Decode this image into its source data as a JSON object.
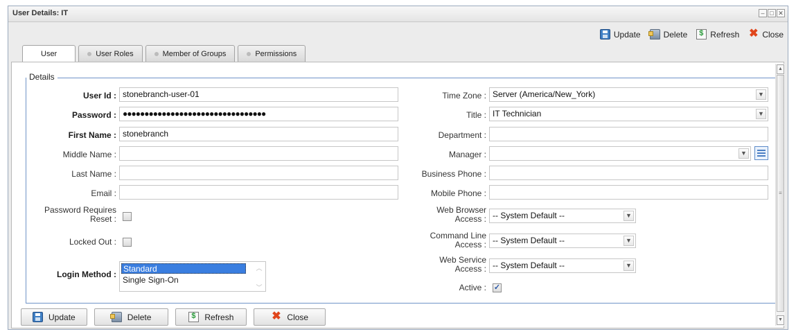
{
  "window": {
    "title": "User Details: IT"
  },
  "toolbar": {
    "update": {
      "label": "Update",
      "icon": "save-icon"
    },
    "delete": {
      "label": "Delete",
      "icon": "delete-icon"
    },
    "refresh": {
      "label": "Refresh",
      "icon": "refresh-icon"
    },
    "close": {
      "label": "Close",
      "icon": "close-icon"
    }
  },
  "tabs": [
    {
      "label": "User",
      "active": true
    },
    {
      "label": "User Roles",
      "active": false
    },
    {
      "label": "Member of Groups",
      "active": false
    },
    {
      "label": "Permissions",
      "active": false
    }
  ],
  "details": {
    "legend": "Details",
    "user_id": {
      "label": "User Id :",
      "value": "stonebranch-user-01"
    },
    "password": {
      "label": "Password :",
      "value": "●●●●●●●●●●●●●●●●●●●●●●●●●●●●●●●●●"
    },
    "first_name": {
      "label": "First Name :",
      "value": "stonebranch"
    },
    "middle_name": {
      "label": "Middle Name :",
      "value": ""
    },
    "last_name": {
      "label": "Last Name :",
      "value": ""
    },
    "email": {
      "label": "Email :",
      "value": ""
    },
    "password_reset": {
      "label_1": "Password Requires",
      "label_2": "Reset :",
      "checked": false
    },
    "locked_out": {
      "label": "Locked Out :",
      "checked": false
    },
    "login_method": {
      "label": "Login Method :",
      "options": [
        "Standard",
        "Single Sign-On"
      ],
      "selected": "Standard"
    },
    "time_zone": {
      "label": "Time Zone :",
      "value": "Server (America/New_York)"
    },
    "title": {
      "label": "Title :",
      "value": "IT Technician"
    },
    "department": {
      "label": "Department :",
      "value": ""
    },
    "manager": {
      "label": "Manager :",
      "value": ""
    },
    "business_phone": {
      "label": "Business Phone :",
      "value": ""
    },
    "mobile_phone": {
      "label": "Mobile Phone :",
      "value": ""
    },
    "web_browser_access": {
      "label_1": "Web Browser",
      "label_2": "Access :",
      "value": "-- System Default --"
    },
    "command_line_access": {
      "label_1": "Command Line",
      "label_2": "Access :",
      "value": "-- System Default --"
    },
    "web_service_access": {
      "label_1": "Web Service",
      "label_2": "Access :",
      "value": "-- System Default --"
    },
    "active": {
      "label": "Active :",
      "checked": true
    }
  },
  "bottom_buttons": {
    "update": "Update",
    "delete": "Delete",
    "refresh": "Refresh",
    "close": "Close"
  },
  "colors": {
    "accent": "#3a7ee0",
    "fieldset_border": "#6f93c7",
    "close_red": "#e0451b"
  }
}
